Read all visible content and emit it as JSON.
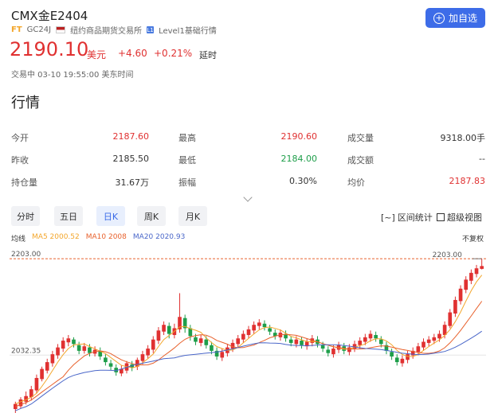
{
  "header": {
    "title": "CMX金E2404",
    "tag_ft": "FT",
    "code": "GC24J",
    "exchange": "纽约商品期货交易所",
    "level": "Level1基础行情",
    "level_badge": "L1",
    "add_button": "加自选",
    "add_icon": "+"
  },
  "quote": {
    "price": "2190.10",
    "currency": "美元",
    "change": "+4.60",
    "change_pct": "+0.21%",
    "delay_label": "延时",
    "status_time": "交易中 03-10 19:55:00 美东时间"
  },
  "section_title": "行情",
  "stats": [
    {
      "label": "今开",
      "value": "2187.60",
      "color": "red"
    },
    {
      "label": "最高",
      "value": "2190.60",
      "color": "red"
    },
    {
      "label": "成交量",
      "value": "9318.00手",
      "color": ""
    },
    {
      "label": "昨收",
      "value": "2185.50",
      "color": ""
    },
    {
      "label": "最低",
      "value": "2184.00",
      "color": "green"
    },
    {
      "label": "成交额",
      "value": "--",
      "color": ""
    },
    {
      "label": "持仓量",
      "value": "31.67万",
      "color": ""
    },
    {
      "label": "振幅",
      "value": "0.30%",
      "color": ""
    },
    {
      "label": "均价",
      "value": "2187.83",
      "color": "red"
    }
  ],
  "tabs": [
    "分时",
    "五日",
    "日K",
    "周K",
    "月K"
  ],
  "active_tab": "日K",
  "tools": {
    "range_stats": "区间统计",
    "range_icon": "[~]",
    "super_view": "超级视图"
  },
  "legend": {
    "label": "均线",
    "ma5": "MA5 2000.52",
    "ma10": "MA10 2008",
    "ma20": "MA20 2020.93",
    "adjust": "不复权"
  },
  "colors": {
    "up": "#e03131",
    "down": "#1e9e4a",
    "accent": "#3d6ce8",
    "ma5": "#f3a62b",
    "ma10": "#e8612c",
    "ma20": "#4a67c9"
  },
  "chart_data": {
    "type": "candlestick",
    "y_ticks": [
      "2203.00",
      "2032.35"
    ],
    "high_marker": "2203.00",
    "ylim": [
      1930,
      2213
    ],
    "candles": [
      [
        1937,
        1946,
        1930,
        1950
      ],
      [
        1942,
        1954,
        1938,
        1958
      ],
      [
        1950,
        1960,
        1945,
        1968
      ],
      [
        1958,
        1972,
        1952,
        1978
      ],
      [
        1970,
        1992,
        1965,
        1998
      ],
      [
        1990,
        2008,
        1986,
        2012
      ],
      [
        2005,
        2020,
        2000,
        2026
      ],
      [
        2018,
        2034,
        2012,
        2040
      ],
      [
        2032,
        2046,
        2026,
        2052
      ],
      [
        2044,
        2058,
        2038,
        2064
      ],
      [
        2055,
        2062,
        2048,
        2068
      ],
      [
        2060,
        2052,
        2046,
        2064
      ],
      [
        2050,
        2040,
        2034,
        2056
      ],
      [
        2040,
        2048,
        2035,
        2054
      ],
      [
        2046,
        2036,
        2030,
        2052
      ],
      [
        2035,
        2042,
        2030,
        2048
      ],
      [
        2040,
        2030,
        2024,
        2046
      ],
      [
        2028,
        2020,
        2014,
        2034
      ],
      [
        2018,
        2012,
        2006,
        2024
      ],
      [
        2010,
        2002,
        1996,
        2016
      ],
      [
        2000,
        2008,
        1995,
        2014
      ],
      [
        2005,
        2018,
        2000,
        2022
      ],
      [
        2016,
        2010,
        2004,
        2022
      ],
      [
        2012,
        2024,
        2006,
        2028
      ],
      [
        2022,
        2034,
        2016,
        2040
      ],
      [
        2032,
        2044,
        2026,
        2050
      ],
      [
        2042,
        2060,
        2036,
        2066
      ],
      [
        2058,
        2076,
        2052,
        2082
      ],
      [
        2074,
        2086,
        2068,
        2092
      ],
      [
        2084,
        2070,
        2062,
        2090
      ],
      [
        2068,
        2080,
        2062,
        2088
      ],
      [
        2078,
        2100,
        2072,
        2142
      ],
      [
        2098,
        2080,
        2072,
        2104
      ],
      [
        2080,
        2066,
        2058,
        2086
      ],
      [
        2064,
        2056,
        2050,
        2070
      ],
      [
        2054,
        2062,
        2048,
        2068
      ],
      [
        2060,
        2050,
        2044,
        2066
      ],
      [
        2050,
        2040,
        2034,
        2056
      ],
      [
        2040,
        2030,
        2024,
        2046
      ],
      [
        2028,
        2038,
        2022,
        2044
      ],
      [
        2036,
        2046,
        2030,
        2052
      ],
      [
        2044,
        2054,
        2038,
        2060
      ],
      [
        2052,
        2062,
        2046,
        2068
      ],
      [
        2060,
        2070,
        2054,
        2076
      ],
      [
        2068,
        2078,
        2062,
        2084
      ],
      [
        2076,
        2086,
        2070,
        2092
      ],
      [
        2084,
        2090,
        2078,
        2096
      ],
      [
        2088,
        2082,
        2076,
        2094
      ],
      [
        2080,
        2074,
        2068,
        2086
      ],
      [
        2072,
        2066,
        2060,
        2078
      ],
      [
        2064,
        2072,
        2058,
        2078
      ],
      [
        2070,
        2062,
        2056,
        2076
      ],
      [
        2060,
        2054,
        2048,
        2066
      ],
      [
        2052,
        2060,
        2046,
        2066
      ],
      [
        2058,
        2050,
        2044,
        2064
      ],
      [
        2048,
        2056,
        2042,
        2062
      ],
      [
        2054,
        2062,
        2048,
        2068
      ],
      [
        2060,
        2052,
        2046,
        2066
      ],
      [
        2050,
        2044,
        2038,
        2056
      ],
      [
        2042,
        2036,
        2030,
        2048
      ],
      [
        2034,
        2044,
        2028,
        2050
      ],
      [
        2042,
        2050,
        2036,
        2056
      ],
      [
        2048,
        2040,
        2034,
        2054
      ],
      [
        2038,
        2046,
        2032,
        2052
      ],
      [
        2044,
        2052,
        2038,
        2058
      ],
      [
        2050,
        2058,
        2044,
        2064
      ],
      [
        2056,
        2064,
        2050,
        2070
      ],
      [
        2062,
        2070,
        2056,
        2076
      ],
      [
        2068,
        2062,
        2056,
        2074
      ],
      [
        2060,
        2052,
        2046,
        2066
      ],
      [
        2050,
        2040,
        2034,
        2056
      ],
      [
        2038,
        2030,
        2024,
        2044
      ],
      [
        2028,
        2020,
        2014,
        2034
      ],
      [
        2018,
        2026,
        2012,
        2032
      ],
      [
        2024,
        2034,
        2018,
        2040
      ],
      [
        2032,
        2040,
        2026,
        2046
      ],
      [
        2038,
        2048,
        2032,
        2054
      ],
      [
        2046,
        2056,
        2040,
        2062
      ],
      [
        2054,
        2060,
        2048,
        2066
      ],
      [
        2058,
        2064,
        2052,
        2070
      ],
      [
        2062,
        2070,
        2056,
        2076
      ],
      [
        2068,
        2086,
        2062,
        2092
      ],
      [
        2084,
        2108,
        2080,
        2114
      ],
      [
        2106,
        2130,
        2100,
        2136
      ],
      [
        2128,
        2150,
        2122,
        2156
      ],
      [
        2148,
        2166,
        2142,
        2172
      ],
      [
        2164,
        2178,
        2158,
        2184
      ],
      [
        2176,
        2186,
        2170,
        2192
      ],
      [
        2185,
        2190,
        2184,
        2203
      ]
    ]
  }
}
